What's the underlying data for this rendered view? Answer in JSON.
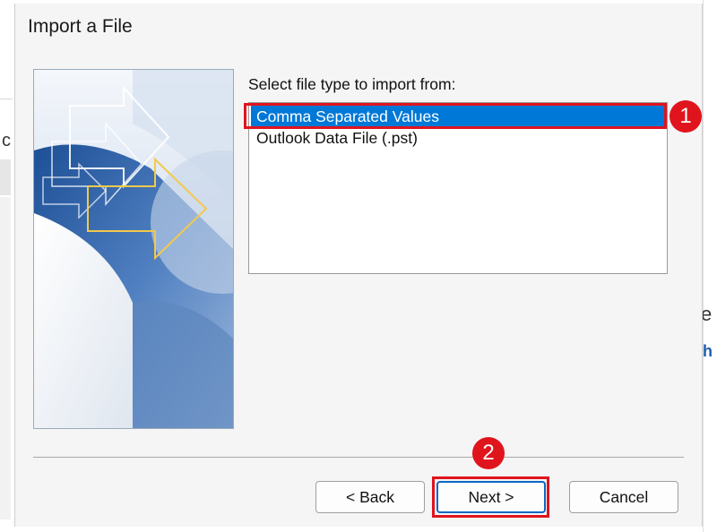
{
  "dialog": {
    "title": "Import a File",
    "prompt": "Select file type to import from:",
    "file_types": [
      {
        "label": "Comma Separated Values",
        "selected": true
      },
      {
        "label": "Outlook Data File (.pst)",
        "selected": false
      }
    ],
    "buttons": {
      "back": "< Back",
      "next": "Next >",
      "cancel": "Cancel"
    }
  },
  "annotations": {
    "step1": "1",
    "step2": "2",
    "color": "#e0141d"
  },
  "background": {
    "left_char": "c",
    "right_char_1": "e",
    "right_char_2": "h"
  },
  "colors": {
    "selection": "#0078d7",
    "dialog_bg": "#f5f5f5",
    "primary_border": "#0b67c4"
  }
}
